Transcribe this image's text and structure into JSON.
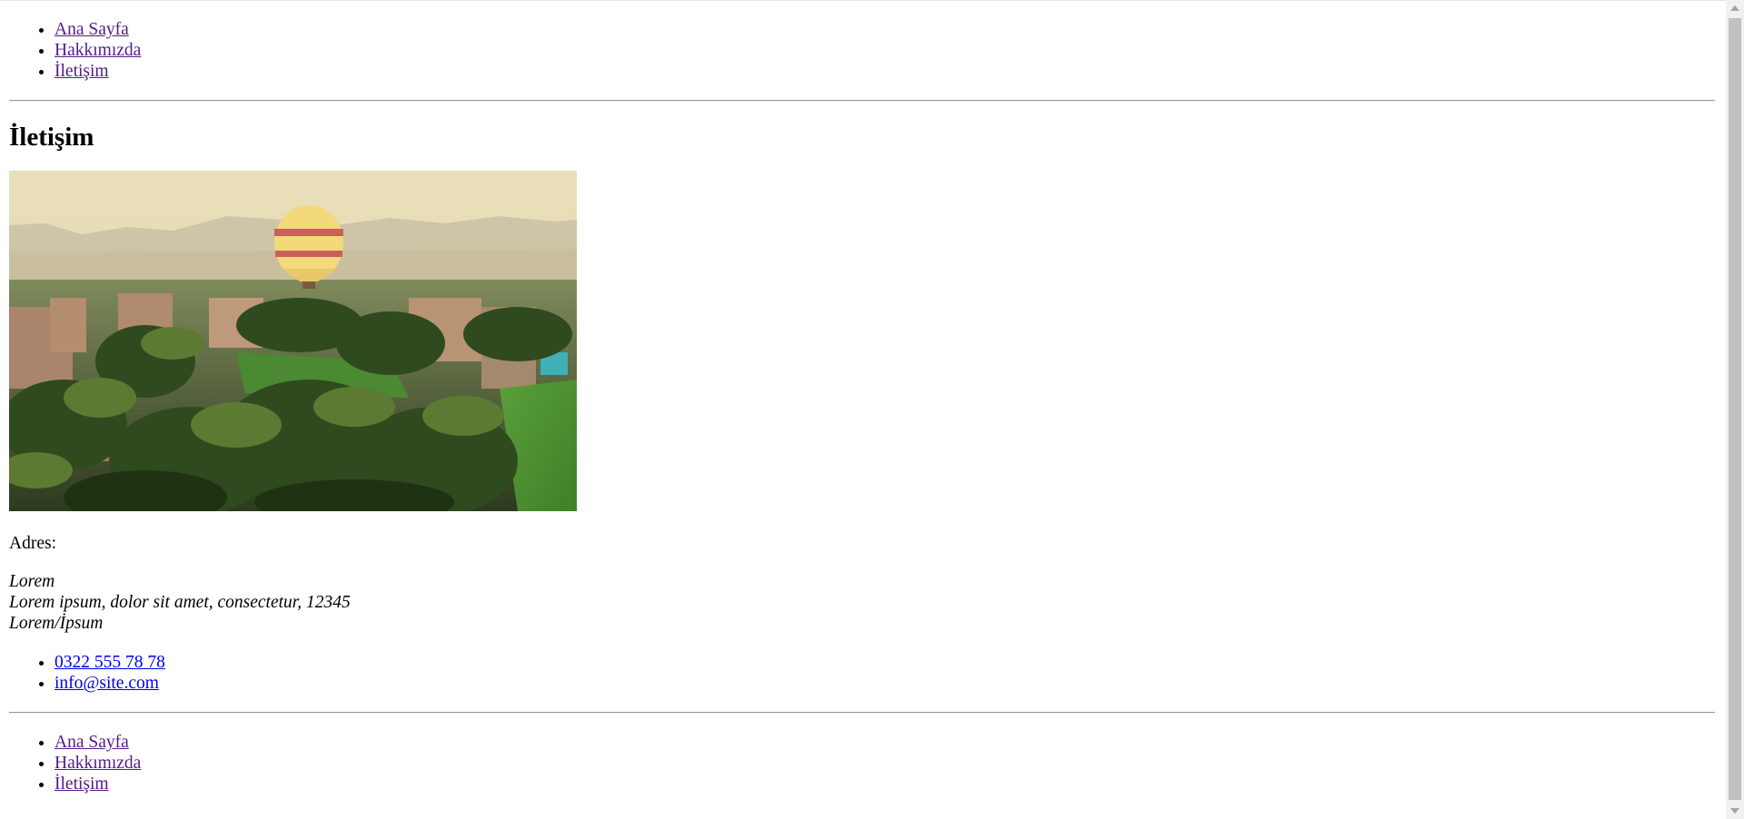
{
  "nav_top": {
    "items": [
      {
        "label": "Ana Sayfa"
      },
      {
        "label": "Hakkımızda"
      },
      {
        "label": "İletişim"
      }
    ]
  },
  "main": {
    "title": "İletişim",
    "image_icon": "balloon-over-palm-trees-photo",
    "address_label": "Adres:",
    "address_lines": [
      "Lorem",
      "Lorem ipsum, dolor sit amet, consectetur, 12345",
      "Lorem/İpsum"
    ],
    "contacts": [
      {
        "label": "0322 555 78 78"
      },
      {
        "label": "info@site.com"
      }
    ]
  },
  "nav_bottom": {
    "items": [
      {
        "label": "Ana Sayfa"
      },
      {
        "label": "Hakkımızda"
      },
      {
        "label": "İletişim"
      }
    ]
  },
  "colors": {
    "link": "#0000ee",
    "visited_link": "#551a8b",
    "scrollbar_thumb": "#c1c1c1"
  }
}
